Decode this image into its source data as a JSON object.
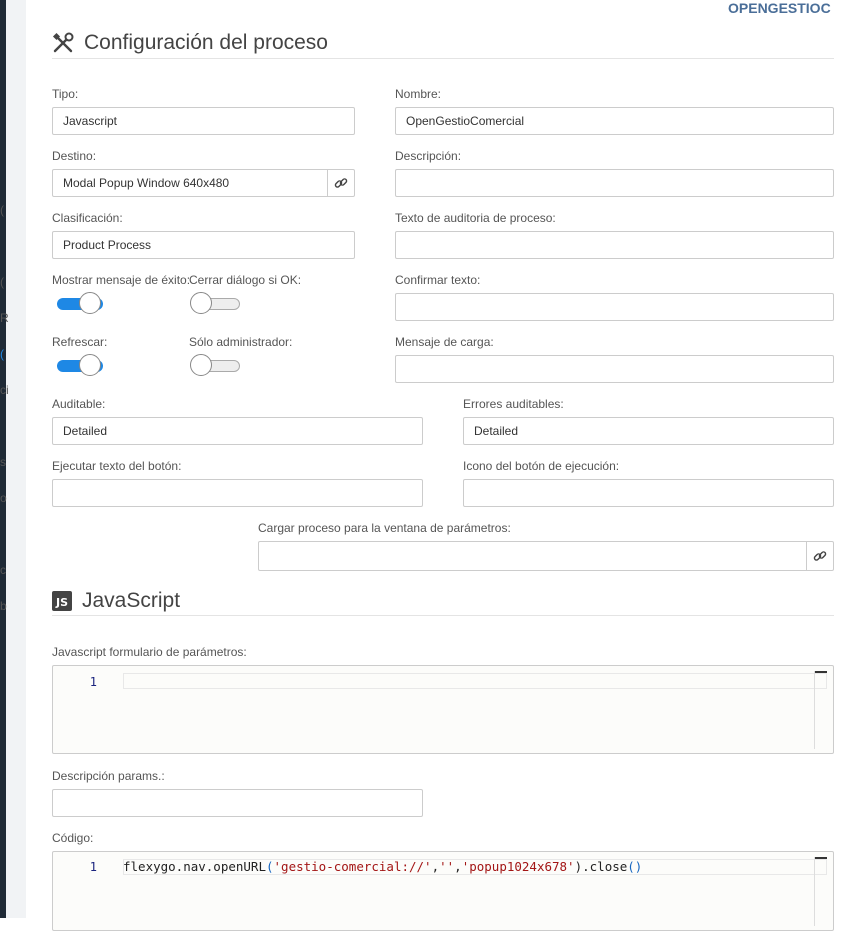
{
  "app_header": {
    "brand_text": "OPENGESTIOC"
  },
  "left_edge_chars": [
    "(",
    "(",
    "R",
    "(",
    "ci",
    "s",
    "o",
    "c",
    "b"
  ],
  "config_section": {
    "title": "Configuración del proceso",
    "icon": "tools-icon",
    "fields": {
      "tipo": {
        "label": "Tipo:",
        "value": "Javascript"
      },
      "nombre": {
        "label": "Nombre:",
        "value": "OpenGestioComercial"
      },
      "destino": {
        "label": "Destino:",
        "value": "Modal Popup Window 640x480"
      },
      "descripcion": {
        "label": "Descripción:",
        "value": ""
      },
      "clasificacion": {
        "label": "Clasificación:",
        "value": "Product Process"
      },
      "texto_auditoria": {
        "label": "Texto de auditoria de proceso:",
        "value": ""
      },
      "mostrar_mensaje": {
        "label": "Mostrar mensaje de éxito:",
        "on": true
      },
      "cerrar_dialogo": {
        "label": "Cerrar diálogo si OK:",
        "on": false
      },
      "confirmar_texto": {
        "label": "Confirmar texto:",
        "value": ""
      },
      "refrescar": {
        "label": "Refrescar:",
        "on": true
      },
      "solo_admin": {
        "label": "Sólo administrador:",
        "on": false
      },
      "mensaje_carga": {
        "label": "Mensaje de carga:",
        "value": ""
      },
      "auditable": {
        "label": "Auditable:",
        "value": "Detailed"
      },
      "errores_auditables": {
        "label": "Errores auditables:",
        "value": "Detailed"
      },
      "ejecutar_texto": {
        "label": "Ejecutar texto del botón:",
        "value": ""
      },
      "icono_boton": {
        "label": "Icono del botón de ejecución:",
        "value": ""
      },
      "cargar_proceso": {
        "label": "Cargar proceso para la ventana de parámetros:",
        "value": ""
      }
    }
  },
  "js_section": {
    "title": "JavaScript",
    "icon": "js-icon",
    "params_editor": {
      "label": "Javascript formulario de parámetros:",
      "line_number": "1",
      "code": ""
    },
    "descripcion_params": {
      "label": "Descripción params.:",
      "value": ""
    },
    "codigo_editor": {
      "label": "Código:",
      "line_number": "1",
      "code_parts": {
        "p1": "flexygo.nav.openURL",
        "p2": "(",
        "p3": "'gestio-comercial://'",
        "p4": ",",
        "p5": "''",
        "p6": ",",
        "p7": "'popup1024x678'",
        "p8": ").close",
        "p9": "()"
      }
    }
  },
  "colors": {
    "accent": "#1e88e5",
    "brand": "#4a6e98",
    "string": "#a31515"
  }
}
